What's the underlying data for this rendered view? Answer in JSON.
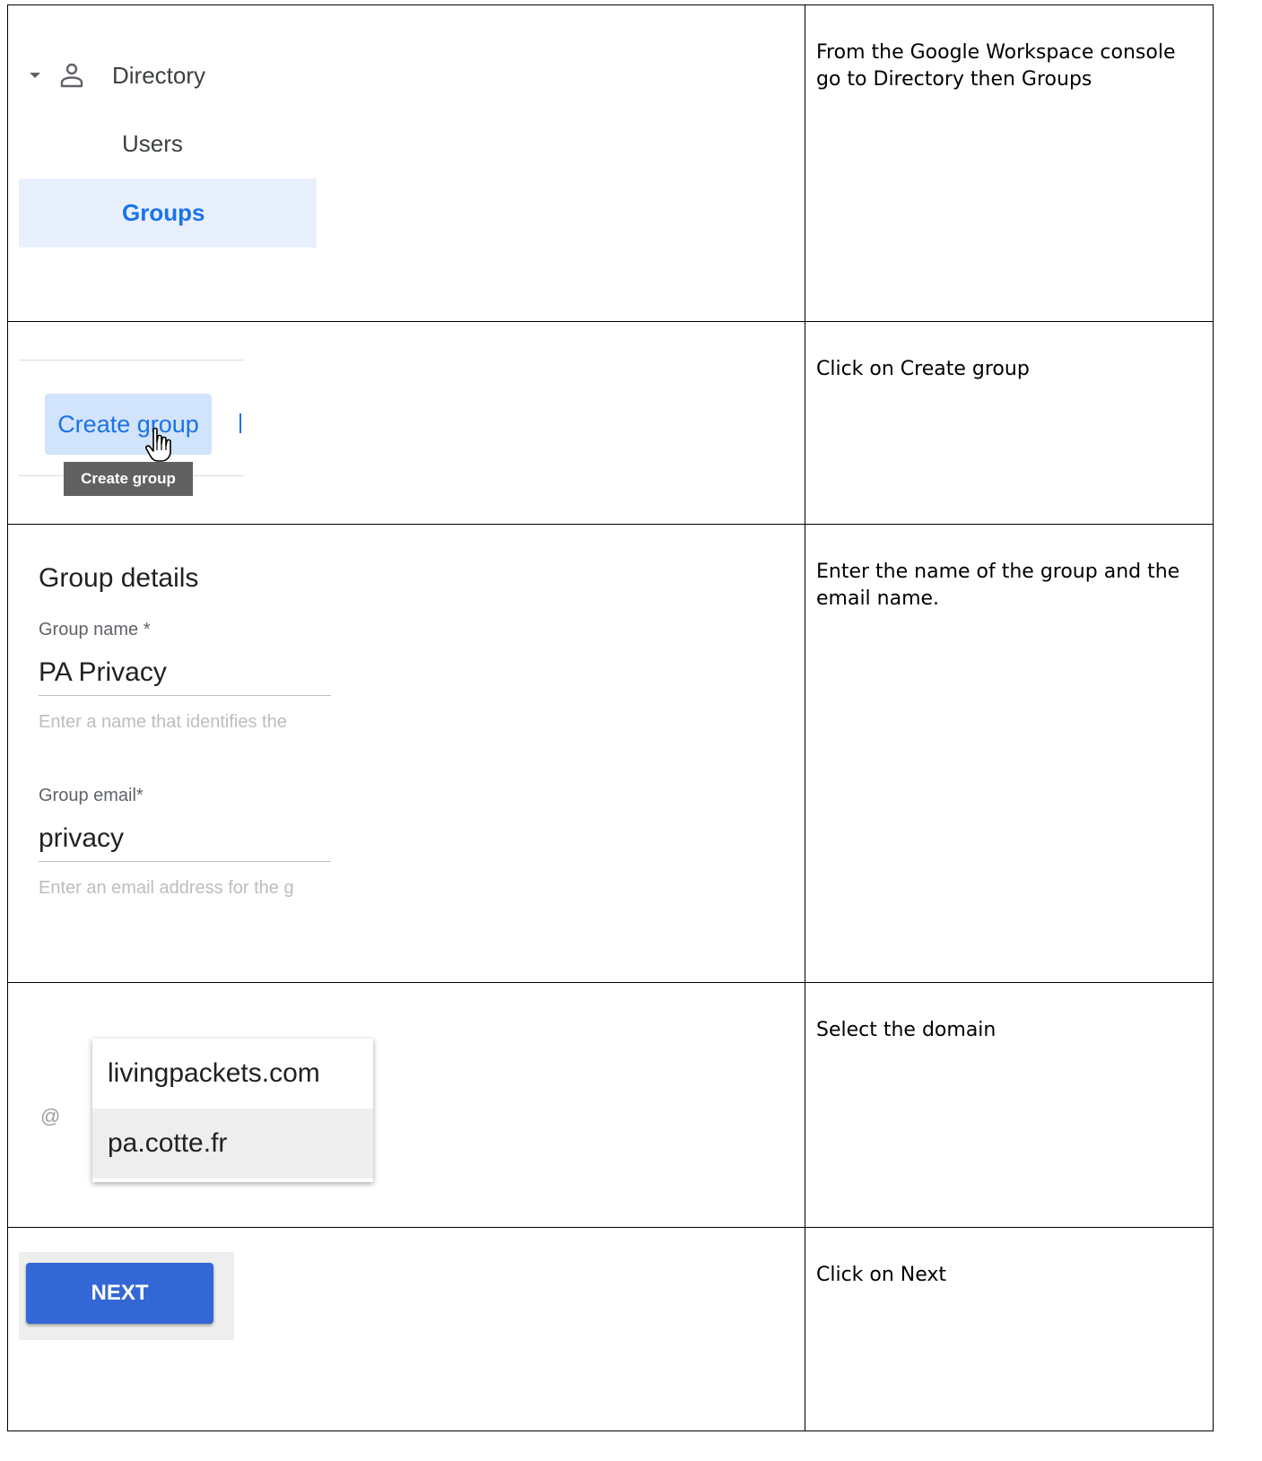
{
  "steps": [
    {
      "instruction": "From the Google Workspace console go to Directory then Groups",
      "nav": {
        "header": "Directory",
        "items": [
          "Users",
          "Groups"
        ],
        "active": "Groups"
      }
    },
    {
      "instruction": "Click on Create group",
      "button_label": "Create group",
      "tooltip": "Create group"
    },
    {
      "instruction": "Enter the name of the group and the email name.",
      "form": {
        "title": "Group details",
        "name_label": "Group name *",
        "name_value": "PA Privacy",
        "name_hint": "Enter a name that identifies the",
        "email_label": "Group email*",
        "email_value": "privacy",
        "email_hint": "Enter an email address for the g"
      }
    },
    {
      "instruction": "Select the domain",
      "at_symbol": "@",
      "domains": [
        "livingpackets.com",
        "pa.cotte.fr"
      ],
      "highlighted": "pa.cotte.fr"
    },
    {
      "instruction": "Click on Next",
      "button_label": "NEXT"
    }
  ],
  "icons": {
    "person": "person-outline-icon",
    "caret": "caret-down-icon",
    "cursor": "hand-pointer-icon"
  },
  "colors": {
    "accent": "#1a73e8",
    "active_bg": "#e8f0fe",
    "create_btn_bg": "#d2e3fc",
    "next_btn_bg": "#3367d6",
    "tooltip_bg": "#616161"
  }
}
